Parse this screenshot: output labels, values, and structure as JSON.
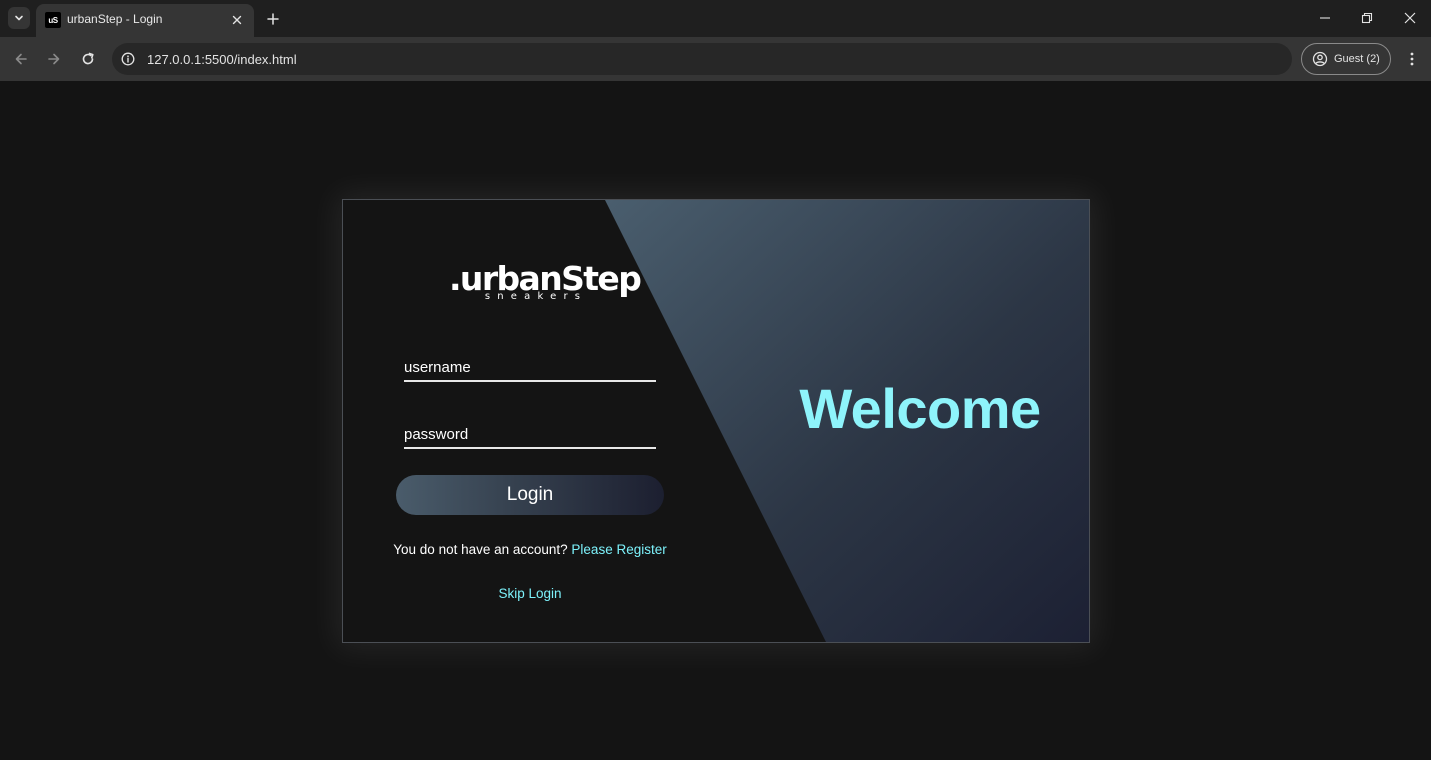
{
  "browser": {
    "tab_title": "urbanStep - Login",
    "favicon_text": "uS",
    "url": "127.0.0.1:5500/index.html",
    "profile_label": "Guest (2)"
  },
  "page": {
    "brand": {
      "name": ".urbanStep",
      "tagline": "sneakers"
    },
    "form": {
      "username_placeholder": "username",
      "password_placeholder": "password",
      "login_label": "Login"
    },
    "register_prompt": "You do not have an account?",
    "register_link": "Please Register",
    "skip_link": "Skip Login",
    "welcome_heading": "Welcome"
  },
  "colors": {
    "accent": "#7df2fb",
    "background": "#141414",
    "panel_gradient_start": "#4a5e6e",
    "panel_gradient_end": "#1c2033"
  }
}
